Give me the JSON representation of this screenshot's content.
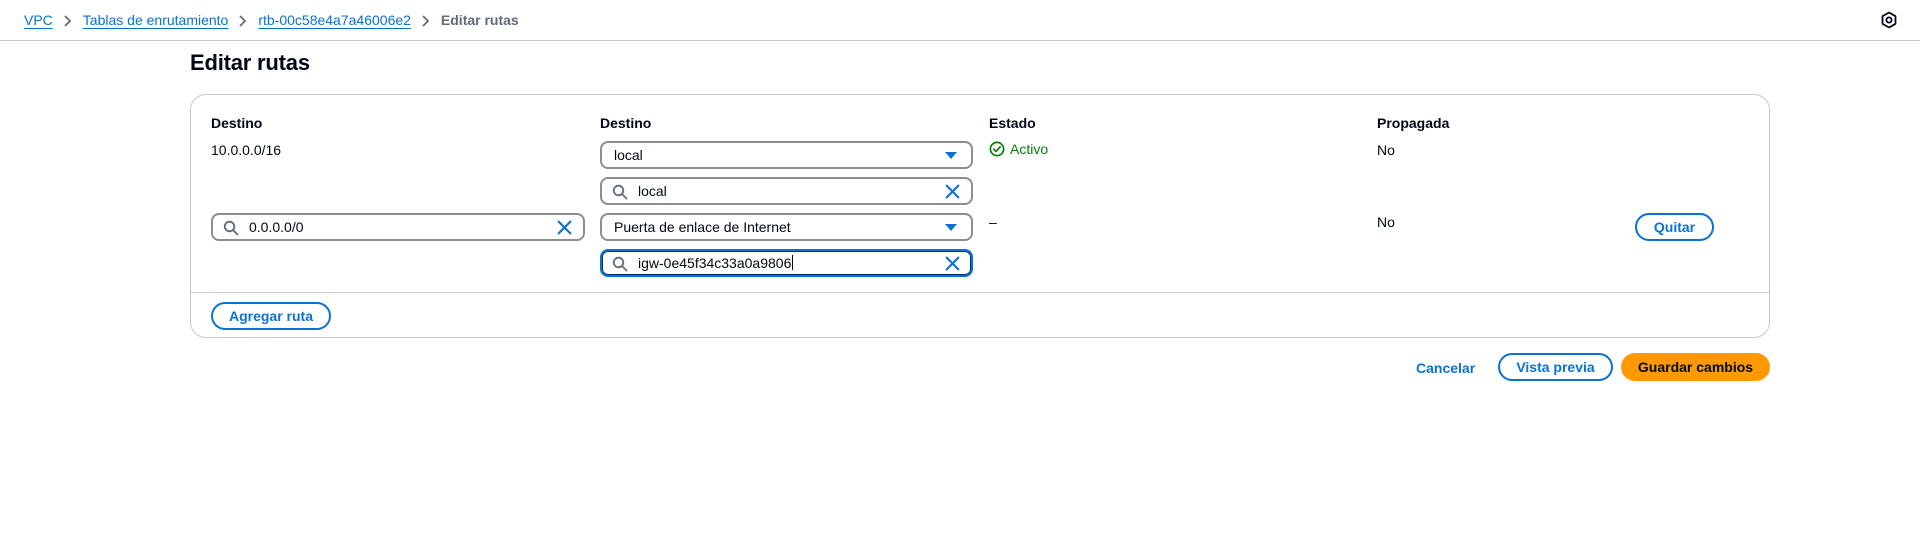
{
  "breadcrumb": {
    "items": [
      "VPC",
      "Tablas de enrutamiento",
      "rtb-00c58e4a7a46006e2"
    ],
    "current": "Editar rutas"
  },
  "page": {
    "title": "Editar rutas"
  },
  "table": {
    "headers": {
      "destination": "Destino",
      "target": "Destino",
      "status": "Estado",
      "propagated": "Propagada"
    },
    "rows": [
      {
        "destination": "10.0.0.0/16",
        "target_select": "local",
        "target_search": "local",
        "status": "Activo",
        "propagated": "No"
      },
      {
        "destination_input": "0.0.0.0/0",
        "target_select": "Puerta de enlace de Internet",
        "target_search": "igw-0e45f34c33a0a9806",
        "status": "–",
        "propagated": "No",
        "remove_label": "Quitar"
      }
    ],
    "add_route_label": "Agregar ruta"
  },
  "actions": {
    "cancel": "Cancelar",
    "preview": "Vista previa",
    "save": "Guardar cambios"
  },
  "colors": {
    "link": "#0972d3",
    "success": "#037f0c",
    "primary_button": "#ff9900",
    "border": "#8c8c94"
  }
}
